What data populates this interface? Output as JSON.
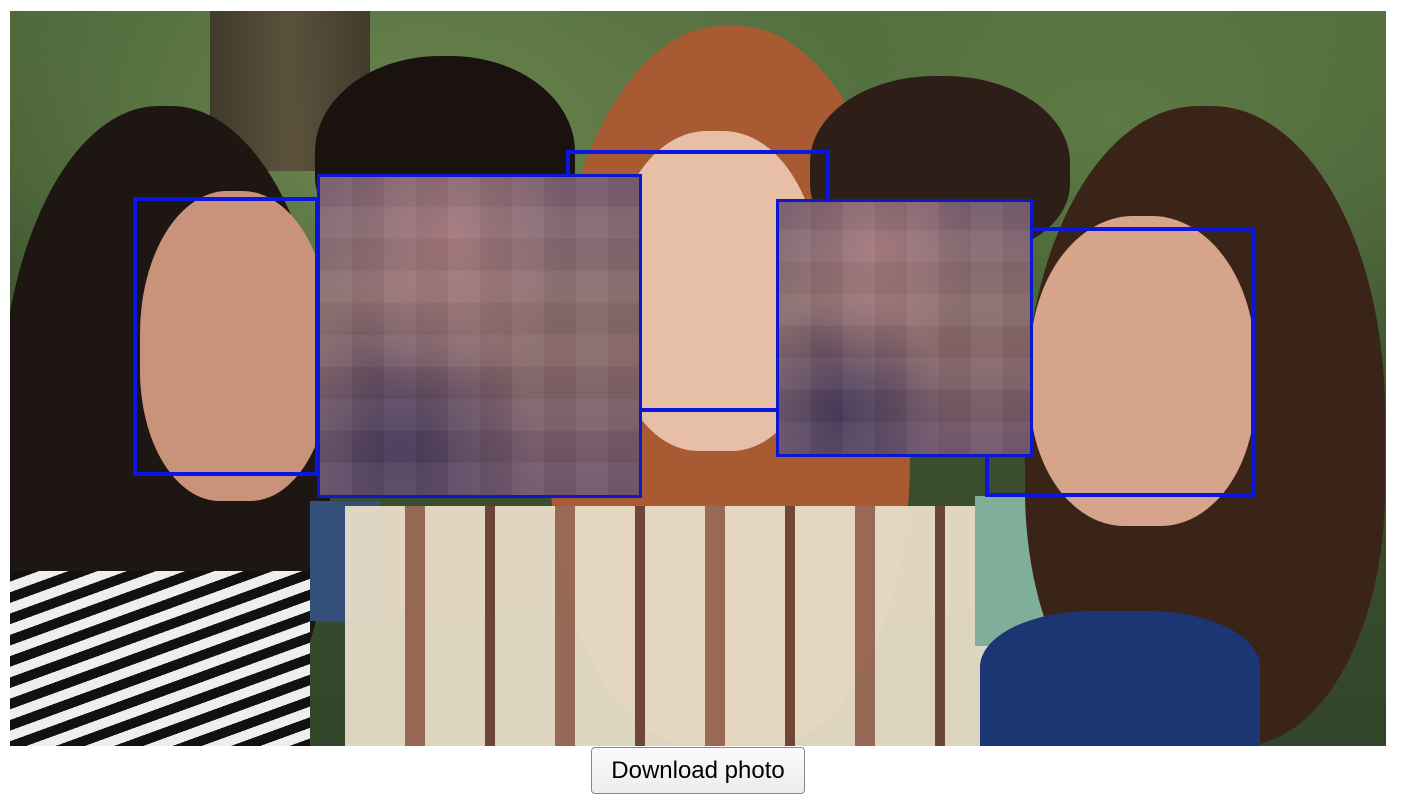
{
  "photo": {
    "description_icon": "group-photo-image",
    "face_box_color": "#0b17e0",
    "faces_detected": 5,
    "faces_blurred": 2
  },
  "actions": {
    "download_label": "Download photo"
  }
}
